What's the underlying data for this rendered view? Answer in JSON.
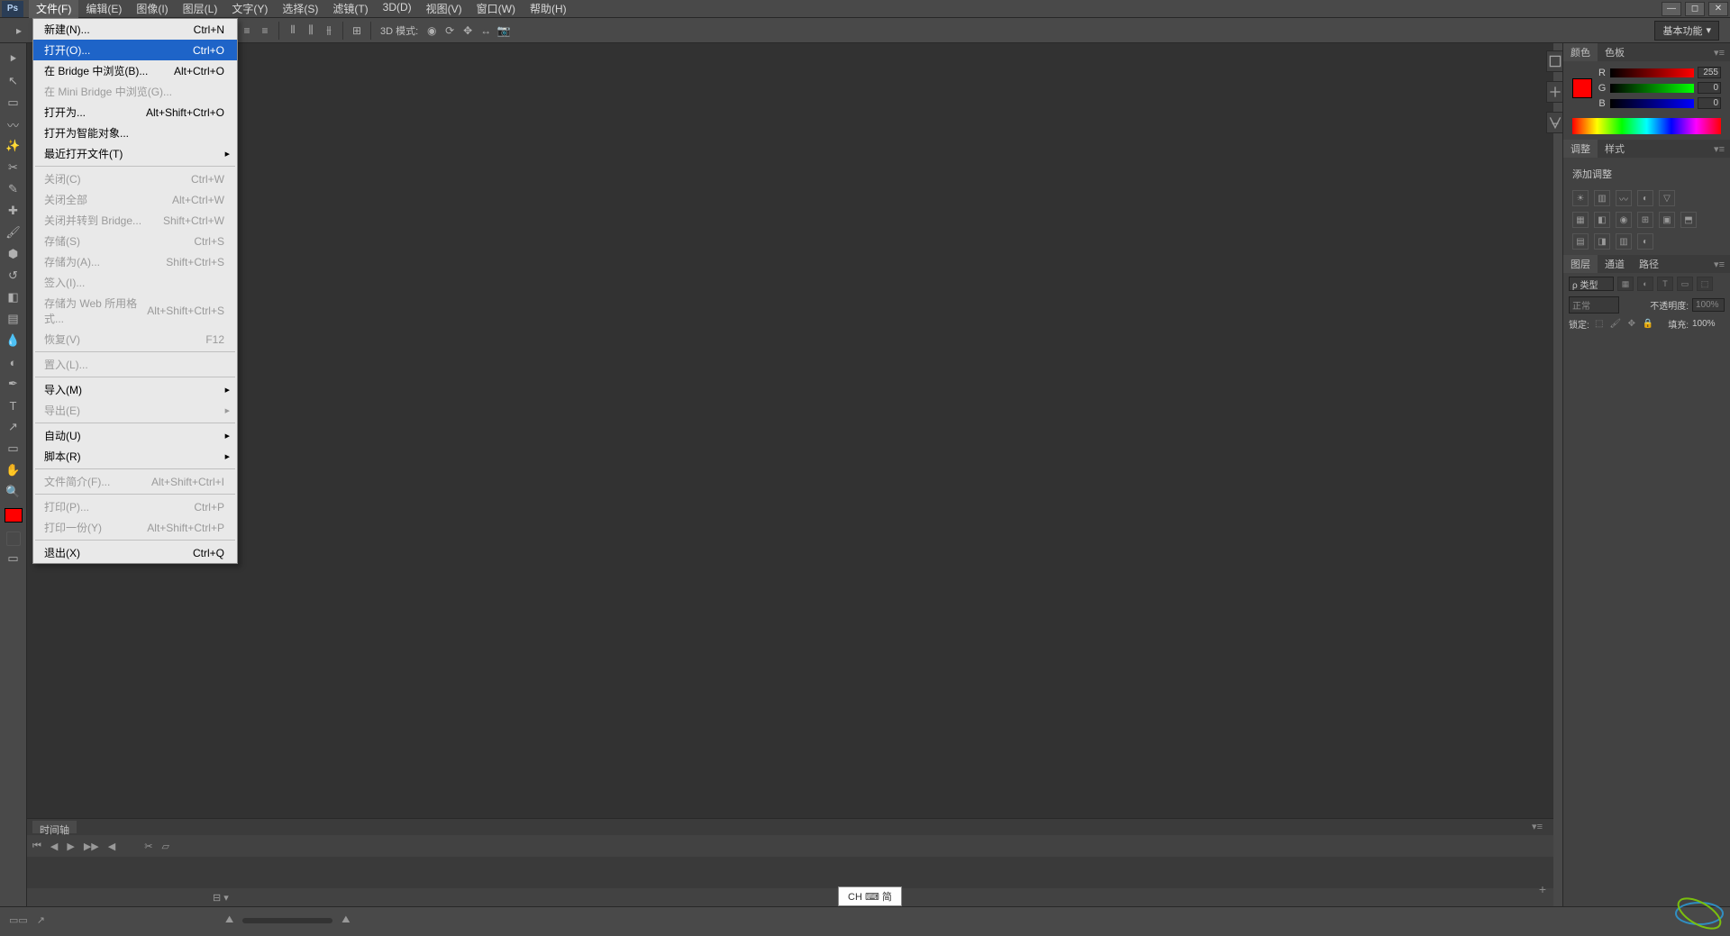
{
  "app": {
    "logo": "Ps"
  },
  "menubar": [
    "文件(F)",
    "编辑(E)",
    "图像(I)",
    "图层(L)",
    "文字(Y)",
    "选择(S)",
    "滤镜(T)",
    "3D(D)",
    "视图(V)",
    "窗口(W)",
    "帮助(H)"
  ],
  "optbar": {
    "mode3d": "3D 模式:"
  },
  "workspace": {
    "label": "基本功能"
  },
  "file_menu": {
    "items": [
      {
        "label": "新建(N)...",
        "shortcut": "Ctrl+N",
        "type": "item"
      },
      {
        "label": "打开(O)...",
        "shortcut": "Ctrl+O",
        "type": "highlight"
      },
      {
        "label": "在 Bridge 中浏览(B)...",
        "shortcut": "Alt+Ctrl+O",
        "type": "item"
      },
      {
        "label": "在 Mini Bridge 中浏览(G)...",
        "shortcut": "",
        "type": "disabled"
      },
      {
        "label": "打开为...",
        "shortcut": "Alt+Shift+Ctrl+O",
        "type": "item"
      },
      {
        "label": "打开为智能对象...",
        "shortcut": "",
        "type": "item"
      },
      {
        "label": "最近打开文件(T)",
        "shortcut": "",
        "type": "sub"
      },
      {
        "type": "sep"
      },
      {
        "label": "关闭(C)",
        "shortcut": "Ctrl+W",
        "type": "disabled"
      },
      {
        "label": "关闭全部",
        "shortcut": "Alt+Ctrl+W",
        "type": "disabled"
      },
      {
        "label": "关闭并转到 Bridge...",
        "shortcut": "Shift+Ctrl+W",
        "type": "disabled"
      },
      {
        "label": "存储(S)",
        "shortcut": "Ctrl+S",
        "type": "disabled"
      },
      {
        "label": "存储为(A)...",
        "shortcut": "Shift+Ctrl+S",
        "type": "disabled"
      },
      {
        "label": "签入(I)...",
        "shortcut": "",
        "type": "disabled"
      },
      {
        "label": "存储为 Web 所用格式...",
        "shortcut": "Alt+Shift+Ctrl+S",
        "type": "disabled"
      },
      {
        "label": "恢复(V)",
        "shortcut": "F12",
        "type": "disabled"
      },
      {
        "type": "sep"
      },
      {
        "label": "置入(L)...",
        "shortcut": "",
        "type": "disabled"
      },
      {
        "type": "sep"
      },
      {
        "label": "导入(M)",
        "shortcut": "",
        "type": "sub"
      },
      {
        "label": "导出(E)",
        "shortcut": "",
        "type": "disabled-sub"
      },
      {
        "type": "sep"
      },
      {
        "label": "自动(U)",
        "shortcut": "",
        "type": "sub"
      },
      {
        "label": "脚本(R)",
        "shortcut": "",
        "type": "sub"
      },
      {
        "type": "sep"
      },
      {
        "label": "文件简介(F)...",
        "shortcut": "Alt+Shift+Ctrl+I",
        "type": "disabled"
      },
      {
        "type": "sep"
      },
      {
        "label": "打印(P)...",
        "shortcut": "Ctrl+P",
        "type": "disabled"
      },
      {
        "label": "打印一份(Y)",
        "shortcut": "Alt+Shift+Ctrl+P",
        "type": "disabled"
      },
      {
        "type": "sep"
      },
      {
        "label": "退出(X)",
        "shortcut": "Ctrl+Q",
        "type": "item"
      }
    ]
  },
  "panels": {
    "color": {
      "tab1": "颜色",
      "tab2": "色板",
      "r": "R",
      "g": "G",
      "b": "B",
      "rv": "255",
      "gv": "0",
      "bv": "0"
    },
    "adjust": {
      "tab1": "调整",
      "tab2": "样式",
      "title": "添加调整"
    },
    "layers": {
      "tab1": "图层",
      "tab2": "通道",
      "tab3": "路径",
      "filter": "ρ 类型",
      "blend": "正常",
      "opacity_label": "不透明度:",
      "opacity": "100%",
      "lock": "锁定:",
      "fill_label": "填充:",
      "fill": "100%"
    }
  },
  "timeline": {
    "tab": "时间轴"
  },
  "ime": {
    "text": "CH ⌨ 简"
  },
  "statusbar": {}
}
